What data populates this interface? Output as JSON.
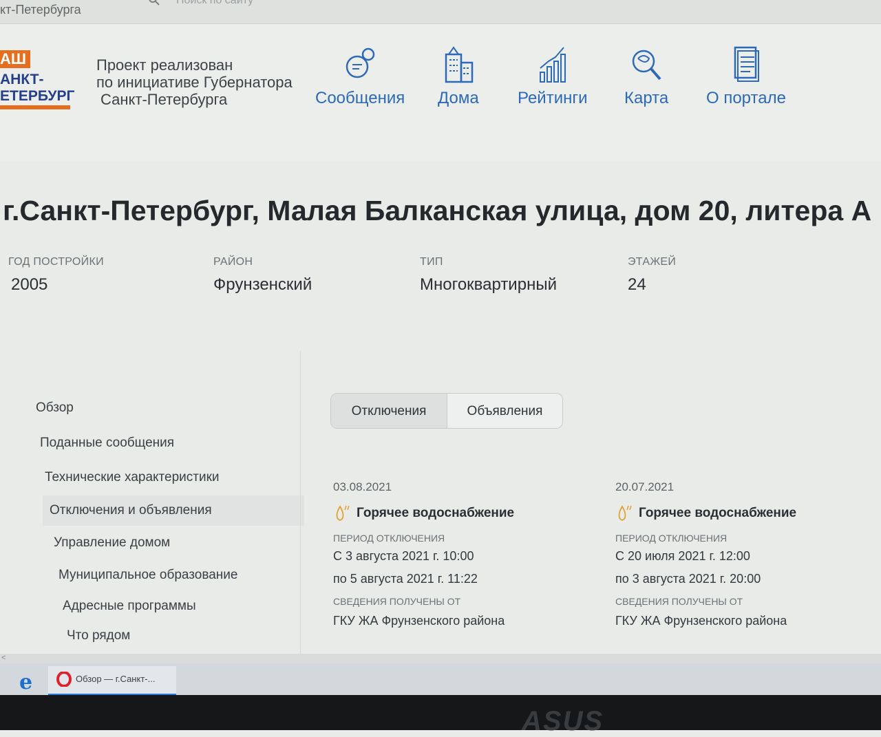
{
  "browser": {
    "top_city_fragment": "кт-Петербурга",
    "search_placeholder": "Поиск по сайту"
  },
  "header": {
    "logo": {
      "line1": "АШ",
      "line2": "АНКТ-",
      "line3": "ЕТЕРБУРГ"
    },
    "project_lines": [
      "Проект реализован",
      "по инициативе Губернатора",
      "Санкт-Петербурга"
    ],
    "nav": [
      {
        "label": "Сообщения",
        "icon": "messages-icon"
      },
      {
        "label": "Дома",
        "icon": "buildings-icon"
      },
      {
        "label": "Рейтинги",
        "icon": "ratings-icon"
      },
      {
        "label": "Карта",
        "icon": "map-search-icon"
      },
      {
        "label": "О портале",
        "icon": "document-icon"
      }
    ]
  },
  "house": {
    "address": "г.Санкт-Петербург, Малая Балканская улица, дом 20, литера А",
    "attributes": [
      {
        "label": "ГОД ПОСТРОЙКИ",
        "value": "2005"
      },
      {
        "label": "РАЙОН",
        "value": "Фрунзенский"
      },
      {
        "label": "ТИП",
        "value": "Многоквартирный"
      },
      {
        "label": "ЭТАЖЕЙ",
        "value": "24"
      }
    ]
  },
  "sidebar": {
    "items": [
      {
        "label": "Обзор"
      },
      {
        "label": "Поданные сообщения"
      },
      {
        "label": "Технические характеристики"
      },
      {
        "label": "Отключения и объявления",
        "active": true
      },
      {
        "label": "Управление домом"
      },
      {
        "label": "Муниципальное образование"
      },
      {
        "label": "Адресные программы"
      },
      {
        "label": "Что рядом"
      }
    ]
  },
  "tabs": [
    {
      "label": "Отключения",
      "selected": true
    },
    {
      "label": "Объявления",
      "selected": false
    }
  ],
  "outages": [
    {
      "date": "03.08.2021",
      "service": "Горячее водоснабжение",
      "period_label": "ПЕРИОД ОТКЛЮЧЕНИЯ",
      "from": "С 3 августа 2021 г. 10:00",
      "to": "по 5 августа 2021 г. 11:22",
      "source_label": "СВЕДЕНИЯ ПОЛУЧЕНЫ ОТ",
      "source": "ГКУ ЖА Фрунзенского района"
    },
    {
      "date": "20.07.2021",
      "service": "Горячее водоснабжение",
      "period_label": "ПЕРИОД ОТКЛЮЧЕНИЯ",
      "from": "С 20 июля 2021 г. 12:00",
      "to": "по 3 августа 2021 г. 20:00",
      "source_label": "СВЕДЕНИЯ ПОЛУЧЕНЫ ОТ",
      "source": "ГКУ ЖА Фрунзенского района"
    }
  ],
  "taskbar": {
    "tab_label": "Обзор — г.Санкт-...",
    "laptop_brand": "ASUS"
  },
  "colors": {
    "accent_blue": "#2c69b8",
    "logo_orange": "#e66f1f",
    "logo_navy": "#263f8c"
  }
}
